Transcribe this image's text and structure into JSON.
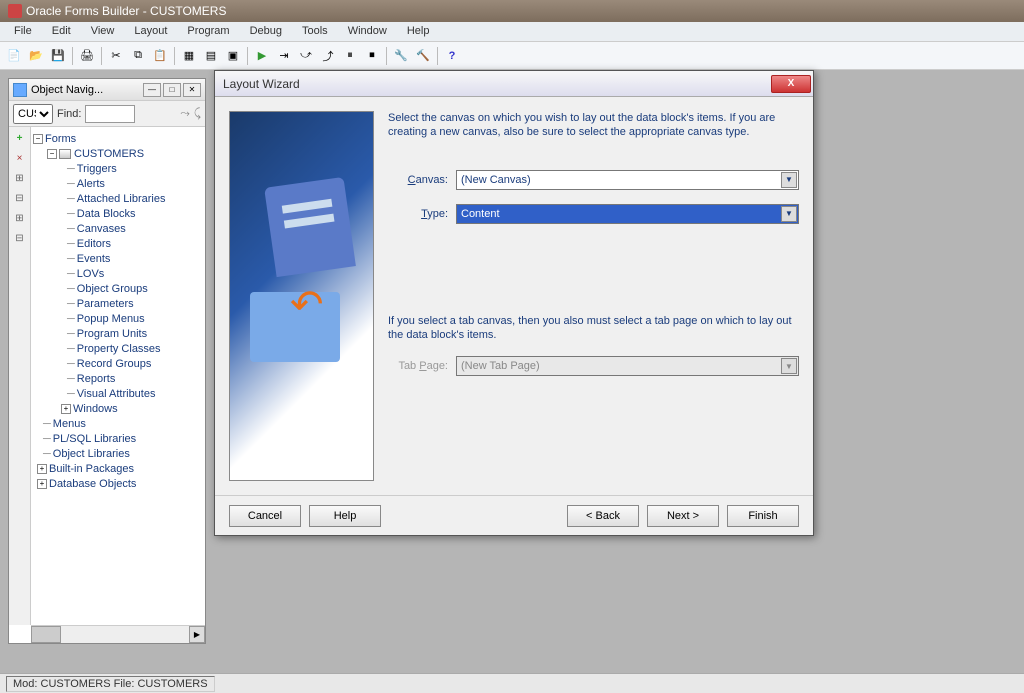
{
  "app": {
    "title": "Oracle Forms Builder - CUSTOMERS"
  },
  "menu": [
    "File",
    "Edit",
    "View",
    "Layout",
    "Program",
    "Debug",
    "Tools",
    "Window",
    "Help"
  ],
  "navigator": {
    "title": "Object Navig...",
    "combo": "CUS",
    "find_label": "Find:",
    "find_value": "",
    "tree": {
      "root": "Forms",
      "module": "CUSTOMERS",
      "children": [
        "Triggers",
        "Alerts",
        "Attached Libraries",
        "Data Blocks",
        "Canvases",
        "Editors",
        "Events",
        "LOVs",
        "Object Groups",
        "Parameters",
        "Popup Menus",
        "Program Units",
        "Property Classes",
        "Record Groups",
        "Reports",
        "Visual Attributes",
        "Windows"
      ],
      "siblings": [
        "Menus",
        "PL/SQL Libraries",
        "Object Libraries",
        "Built-in Packages",
        "Database Objects"
      ]
    }
  },
  "wizard": {
    "title": "Layout Wizard",
    "intro": "Select the canvas on which you wish to lay out the data block's items. If you are creating a new canvas, also be sure to select the appropriate canvas type.",
    "canvas_label": "Canvas:",
    "canvas_value": "(New Canvas)",
    "type_label": "Type:",
    "type_value": "Content",
    "note": "If you select a tab canvas, then you also must select a tab page on which to lay out the data block's items.",
    "tabpage_label": "Tab Page:",
    "tabpage_value": "(New Tab Page)",
    "buttons": {
      "cancel": "Cancel",
      "help": "Help",
      "back": "< Back",
      "next": "Next >",
      "finish": "Finish"
    }
  },
  "status": "Mod: CUSTOMERS File: CUSTOMERS"
}
